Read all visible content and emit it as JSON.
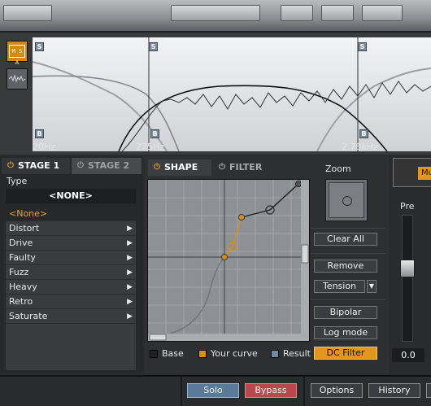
{
  "spectrum": {
    "tool_ms_label": "M S A",
    "tool_ms_icon": "mid-side-icon",
    "tool_wave_icon": "waveform-icon",
    "band_badge_top": "S",
    "band_badge_bottom": "B",
    "freq_labels": [
      "20Hz",
      "275Hz",
      "2.78kHz"
    ]
  },
  "stage_panel": {
    "tabs": [
      {
        "label": "STAGE 1",
        "power_icon": "power-icon"
      },
      {
        "label": "STAGE 2",
        "power_icon": "power-icon"
      }
    ],
    "type_label": "Type",
    "selected_type": "<NONE>",
    "type_items": [
      {
        "label": "<None>",
        "submenu": false,
        "selected": true
      },
      {
        "label": "Distort",
        "submenu": true
      },
      {
        "label": "Drive",
        "submenu": true
      },
      {
        "label": "Faulty",
        "submenu": true
      },
      {
        "label": "Fuzz",
        "submenu": true
      },
      {
        "label": "Heavy",
        "submenu": true
      },
      {
        "label": "Retro",
        "submenu": true
      },
      {
        "label": "Saturate",
        "submenu": true
      }
    ],
    "submenu_arrow": "▶"
  },
  "shape_panel": {
    "tabs": [
      {
        "label": "SHAPE"
      },
      {
        "label": "FILTER"
      }
    ],
    "zoom_label": "Zoom",
    "buttons": {
      "clear_all": "Clear All",
      "remove": "Remove",
      "tension": "Tension",
      "bipolar": "Bipolar",
      "log_mode": "Log mode",
      "dc_filter": "DC Filter"
    },
    "legend": [
      {
        "label": "Base",
        "color": "#222222"
      },
      {
        "label": "Your curve",
        "color": "#d88c1a"
      },
      {
        "label": "Result",
        "color": "#6f8aa8"
      }
    ],
    "accent_color": "#e2961c"
  },
  "output_panel": {
    "mute_label": "Mu",
    "pre_label": "Pre",
    "pre_value": "0.0"
  },
  "bottom_bar": {
    "solo": "Solo",
    "bypass": "Bypass",
    "options": "Options",
    "history": "History"
  }
}
